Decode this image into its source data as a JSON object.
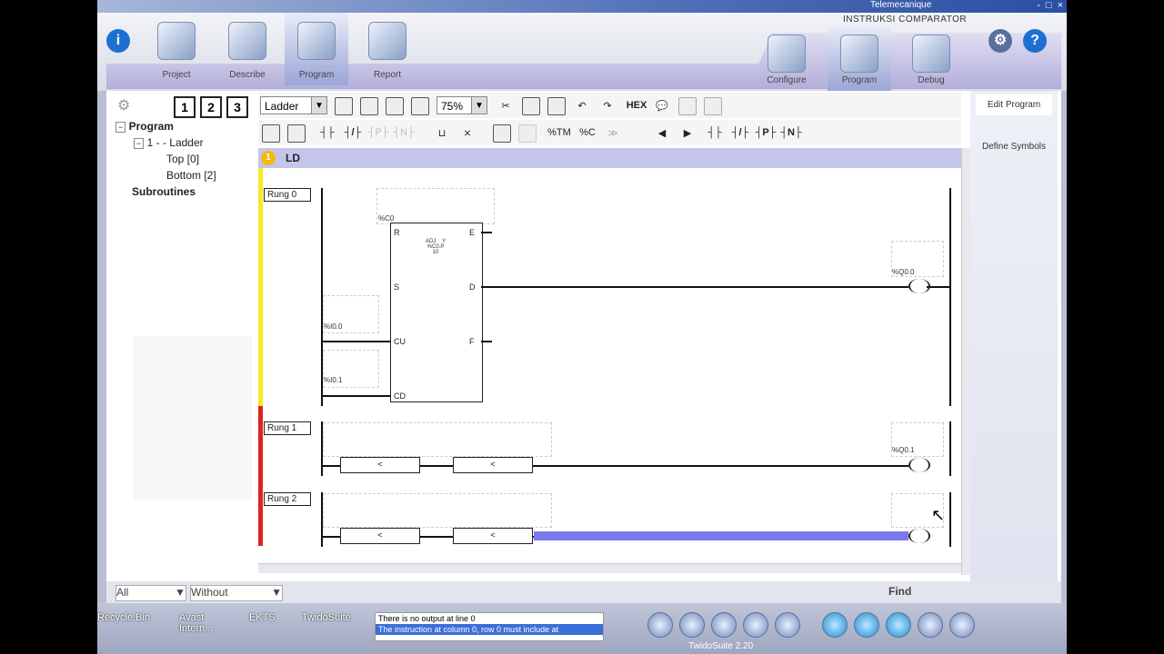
{
  "window": {
    "title": "Telemecanique",
    "controls": [
      "-",
      "□",
      "×"
    ]
  },
  "app": {
    "section_title": "INSTRUKSI COMPARATOR"
  },
  "nav_left": [
    {
      "label": "Project"
    },
    {
      "label": "Describe"
    },
    {
      "label": "Program"
    },
    {
      "label": "Report"
    }
  ],
  "nav_right": [
    {
      "label": "Configure"
    },
    {
      "label": "Program"
    },
    {
      "label": "Debug"
    }
  ],
  "tree": {
    "view_buttons": [
      "1",
      "2",
      "3"
    ],
    "program_label": "Program",
    "section_label": "1 -  - Ladder",
    "top_label": "Top [0]",
    "bottom_label": "Bottom [2]",
    "subroutines_label": "Subroutines"
  },
  "toolbar": {
    "mode_select": "Ladder",
    "zoom_select": "75%",
    "hex_label": "HEX",
    "tm_label": "%TM",
    "c_label": "%C"
  },
  "section": {
    "number": "1",
    "name": "LD"
  },
  "rungs": [
    {
      "label": "Rung 0",
      "block_name": "%C0",
      "block_text": "ADJ    Y\n%C0.P\n10",
      "inputs": [
        "%I0.0",
        "%I0.1"
      ],
      "pins_left": [
        "R",
        "S",
        "CU",
        "CD"
      ],
      "pins_right": [
        "E",
        "D",
        "F"
      ],
      "output": "%Q0.0",
      "bar_color": "#f7ea24"
    },
    {
      "label": "Rung 1",
      "comparators": [
        "<",
        "<"
      ],
      "output": "%Q0.1",
      "bar_color": "#e1231b"
    },
    {
      "label": "Rung 2",
      "comparators": [
        "<",
        "<"
      ],
      "output": "",
      "bar_color": "#e1231b"
    }
  ],
  "right_panel": {
    "edit_program": "Edit Program",
    "define_symbols": "Define Symbols"
  },
  "bottom_bar": {
    "filter_all": "All",
    "filter_without": "Without",
    "find_label": "Find"
  },
  "taskbar": {
    "desktop_items": [
      "Recycle Bin",
      "Avast Intern...",
      "EKTS",
      "TwidoSuite"
    ],
    "message_line1": "There is no output at line 0",
    "message_line2": "The instruction at column 0, row 0 must include at",
    "app_version": "TwidoSuite 2.20"
  }
}
